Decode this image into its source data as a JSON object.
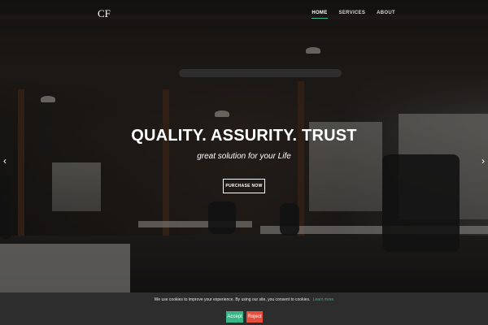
{
  "brand": {
    "logo_text": "CF"
  },
  "nav": {
    "items": [
      {
        "label": "HOME",
        "active": true
      },
      {
        "label": "SERVICES",
        "active": false
      },
      {
        "label": "ABOUT",
        "active": false
      }
    ]
  },
  "hero": {
    "headline": "QUALITY. ASSURITY. TRUST",
    "tagline": "great solution for your Life",
    "cta_label": "PURCHASE NOW",
    "prev_icon": "chevron-left-icon",
    "next_icon": "chevron-right-icon"
  },
  "cookie_bar": {
    "message": "We use cookies to improve your experience. By using our site, you consent to cookies.",
    "link_text": "Learn more",
    "accept_label": "Accept",
    "reject_label": "Reject"
  },
  "colors": {
    "accent": "#39b586",
    "reject": "#e74c3c",
    "cookie_bg": "#2d2d2d"
  }
}
